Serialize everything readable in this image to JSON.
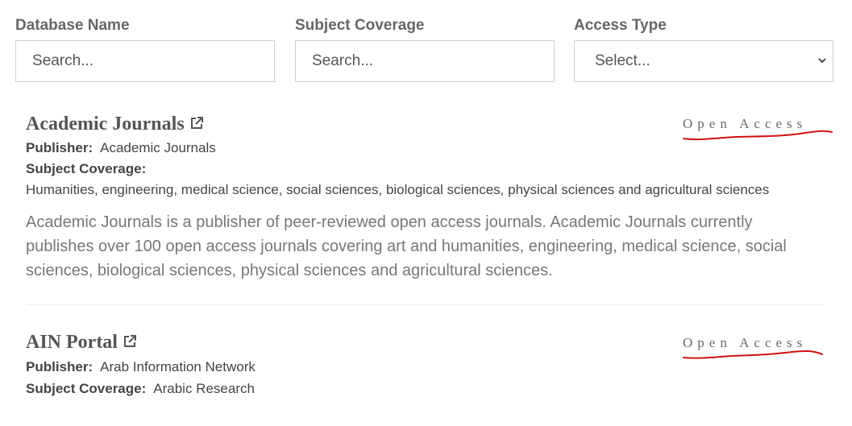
{
  "filters": {
    "database_name": {
      "label": "Database Name",
      "placeholder": "Search..."
    },
    "subject_coverage": {
      "label": "Subject Coverage",
      "placeholder": "Search..."
    },
    "access_type": {
      "label": "Access Type",
      "selected": "Select..."
    }
  },
  "entries": [
    {
      "title": "Academic Journals",
      "access": "Open Access",
      "publisher_label": "Publisher:",
      "publisher": "Academic Journals",
      "coverage_label": "Subject Coverage:",
      "coverage": "Humanities, engineering, medical science, social sciences, biological sciences, physical sciences and agricultural sciences",
      "description": "Academic Journals is a publisher of peer-reviewed open access journals. Academic Journals currently publishes over 100 open access journals covering art and humanities, engineering, medical science, social sciences, biological sciences, physical sciences and agricultural sciences."
    },
    {
      "title": "AIN Portal",
      "access": "Open Access",
      "publisher_label": "Publisher:",
      "publisher": "Arab Information Network",
      "coverage_label": "Subject Coverage:",
      "coverage": "Arabic Research"
    }
  ],
  "icons": {
    "external_link": "external-link-icon",
    "select_arrow": "chevron-down-icon"
  },
  "colors": {
    "annotation_red": "#d01010",
    "border": "#cfcfcf"
  }
}
